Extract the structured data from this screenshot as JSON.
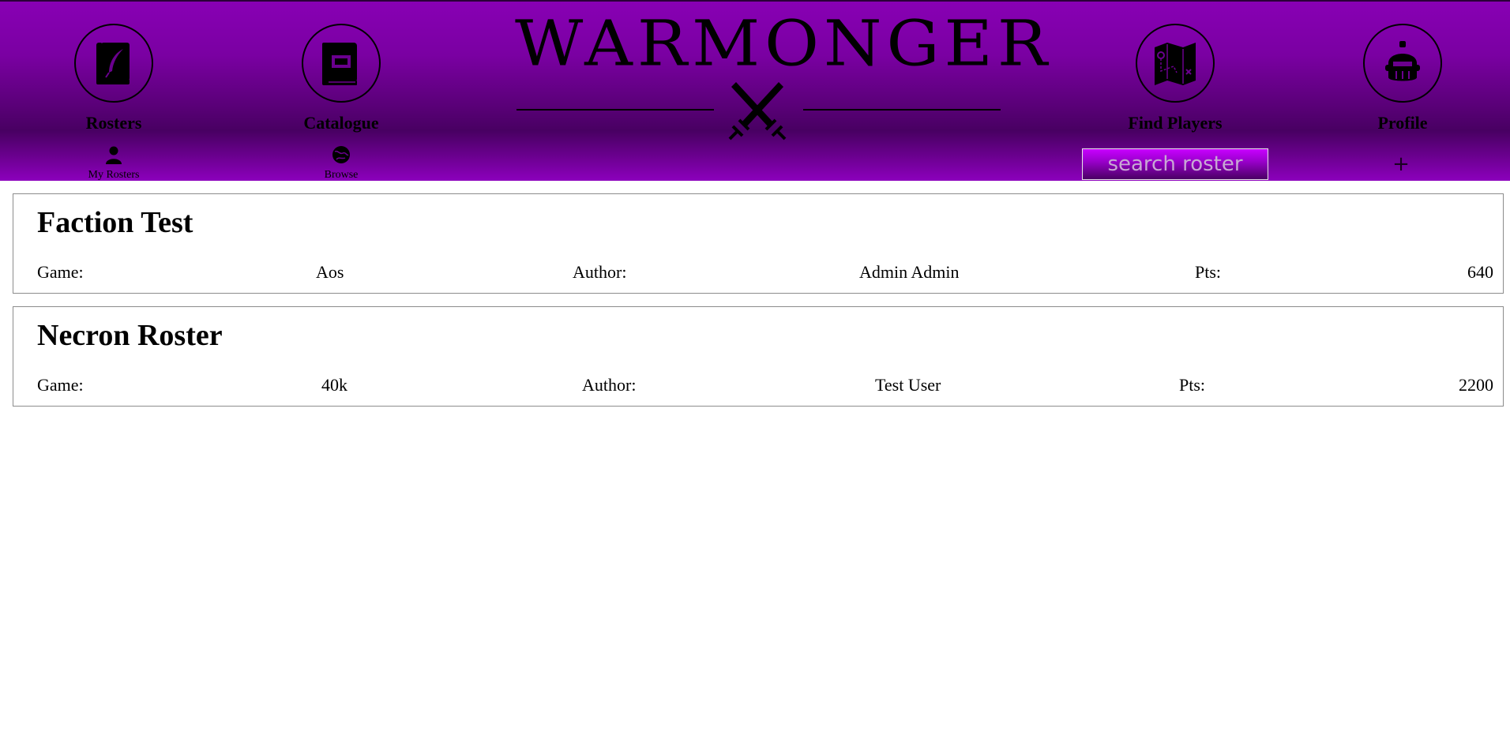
{
  "header": {
    "logo_text": "WARMONGER",
    "nav": [
      {
        "label": "Rosters",
        "sub_label": "My Rosters"
      },
      {
        "label": "Catalogue",
        "sub_label": "Browse"
      },
      {
        "label": "Find Players"
      },
      {
        "label": "Profile"
      }
    ],
    "search": {
      "placeholder": "search roster",
      "value": ""
    },
    "add_label": "+"
  },
  "rosters": [
    {
      "title": "Faction Test",
      "game_label": "Game:",
      "game": "Aos",
      "author_label": "Author:",
      "author": "Admin Admin",
      "pts_label": "Pts:",
      "pts": "640"
    },
    {
      "title": "Necron Roster",
      "game_label": "Game:",
      "game": "40k",
      "author_label": "Author:",
      "author": "Test User",
      "pts_label": "Pts:",
      "pts": "2200"
    }
  ],
  "colors": {
    "header_purple": "#8800b4",
    "header_dark": "#480062",
    "search_bg": "#c800ff"
  }
}
